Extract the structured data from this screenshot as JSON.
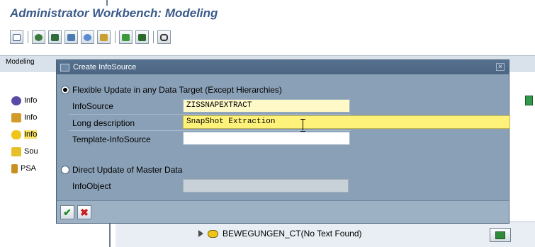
{
  "workbench": {
    "title": "Administrator Workbench: Modeling",
    "tab_label": "Modeling",
    "tree_items": [
      {
        "label": "Info",
        "icon": "infocube-icon",
        "color": "#5a4aa8"
      },
      {
        "label": "Info",
        "icon": "ods-icon",
        "color": "#d29b2a"
      },
      {
        "label": "Info",
        "icon": "infosource-icon",
        "color": "#f0c419"
      },
      {
        "label": "Sou",
        "icon": "source-system-icon",
        "color": "#e6c02a"
      },
      {
        "label": "PSA",
        "icon": "psa-icon",
        "color": "#c89020"
      }
    ],
    "bottom_row_label": "BEWEGUNGEN_CT(No Text Found)"
  },
  "dialog": {
    "title": "Create InfoSource",
    "option_flexible": "Flexible Update in any Data Target (Except Hierarchies)",
    "option_direct": "Direct Update of Master Data",
    "fields": {
      "infosource_label": "InfoSource",
      "infosource_value": "ZISSNAPEXTRACT",
      "long_description_label": "Long description",
      "long_description_value": "SnapShot Extraction",
      "template_label": "Template-InfoSource",
      "template_value": "",
      "infoobject_label": "InfoObject",
      "infoobject_value": ""
    },
    "buttons": {
      "ok_icon": "checkmark-icon",
      "cancel_icon": "cross-icon"
    }
  },
  "colors": {
    "title_blue": "#3a5a8a",
    "dialog_body": "#8aa0b6",
    "dialog_titlebar": "#4b6582",
    "field_active": "#fff27a",
    "selection_yellow": "#fbe36a"
  }
}
